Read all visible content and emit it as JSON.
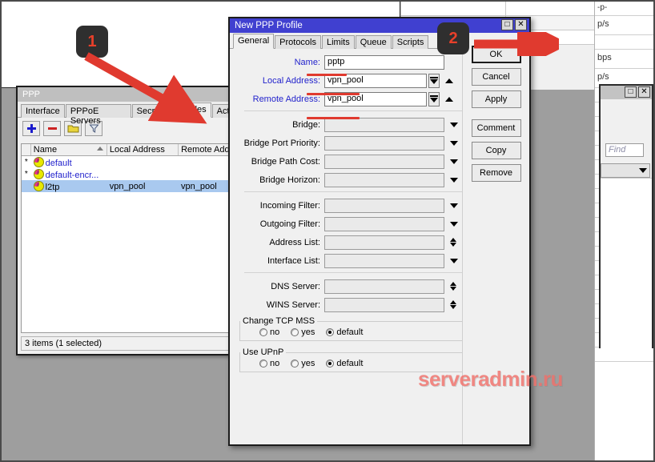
{
  "background": {
    "right_column_rows": [
      "-p-",
      "p/s",
      "",
      "bps",
      "p/s"
    ],
    "find_placeholder": "Find",
    "window_buttons": [
      "maximize-icon",
      "close-icon"
    ]
  },
  "ppp_window": {
    "title": "PPP",
    "tabs": [
      {
        "label": "Interface",
        "active": false
      },
      {
        "label": "PPPoE Servers",
        "active": false
      },
      {
        "label": "Secrets",
        "active": false
      },
      {
        "label": "Profiles",
        "active": true
      },
      {
        "label": "Acti",
        "active": false
      }
    ],
    "toolbar": [
      {
        "name": "add-button",
        "glyph": "+"
      },
      {
        "name": "remove-button",
        "glyph": "−"
      },
      {
        "name": "enable-button",
        "glyph": "folder"
      },
      {
        "name": "filter-button",
        "glyph": "funnel"
      }
    ],
    "columns": [
      "Name",
      "Local Address",
      "Remote Addre"
    ],
    "rows": [
      {
        "flag": "*",
        "name": "default",
        "local": "",
        "remote": "",
        "selected": false
      },
      {
        "flag": "*",
        "name": "default-encr...",
        "local": "",
        "remote": "",
        "selected": false
      },
      {
        "flag": "",
        "name": "l2tp",
        "local": "vpn_pool",
        "remote": "vpn_pool",
        "selected": true
      }
    ],
    "status": "3 items (1 selected)"
  },
  "dialog": {
    "title": "New PPP Profile",
    "window_buttons": [
      "maximize-icon",
      "close-icon"
    ],
    "tabs": [
      {
        "label": "General",
        "active": true
      },
      {
        "label": "Protocols",
        "active": false
      },
      {
        "label": "Limits",
        "active": false
      },
      {
        "label": "Queue",
        "active": false
      },
      {
        "label": "Scripts",
        "active": false
      }
    ],
    "fields": [
      {
        "label": "Name:",
        "value": "pptp",
        "highlight": true,
        "control": "text"
      },
      {
        "label": "Local Address:",
        "value": "vpn_pool",
        "highlight": true,
        "control": "combo-spin"
      },
      {
        "label": "Remote Address:",
        "value": "vpn_pool",
        "highlight": true,
        "control": "combo-spin"
      },
      {
        "label": "Bridge:",
        "value": "",
        "highlight": false,
        "control": "combo"
      },
      {
        "label": "Bridge Port Priority:",
        "value": "",
        "highlight": false,
        "control": "combo"
      },
      {
        "label": "Bridge Path Cost:",
        "value": "",
        "highlight": false,
        "control": "combo"
      },
      {
        "label": "Bridge Horizon:",
        "value": "",
        "highlight": false,
        "control": "combo"
      },
      {
        "label": "Incoming Filter:",
        "value": "",
        "highlight": false,
        "control": "combo"
      },
      {
        "label": "Outgoing Filter:",
        "value": "",
        "highlight": false,
        "control": "combo"
      },
      {
        "label": "Address List:",
        "value": "",
        "highlight": false,
        "control": "spin"
      },
      {
        "label": "Interface List:",
        "value": "",
        "highlight": false,
        "control": "combo"
      },
      {
        "label": "DNS Server:",
        "value": "",
        "highlight": false,
        "control": "spin"
      },
      {
        "label": "WINS Server:",
        "value": "",
        "highlight": false,
        "control": "spin"
      }
    ],
    "groups": [
      {
        "legend": "Change TCP MSS",
        "options": [
          {
            "label": "no",
            "selected": false
          },
          {
            "label": "yes",
            "selected": false
          },
          {
            "label": "default",
            "selected": true
          }
        ]
      },
      {
        "legend": "Use UPnP",
        "options": [
          {
            "label": "no",
            "selected": false
          },
          {
            "label": "yes",
            "selected": false
          },
          {
            "label": "default",
            "selected": true
          }
        ]
      }
    ],
    "buttons": [
      {
        "label": "OK",
        "primary": true
      },
      {
        "label": "Cancel",
        "primary": false
      },
      {
        "label": "Apply",
        "primary": false
      },
      {
        "label": "Comment",
        "primary": false
      },
      {
        "label": "Copy",
        "primary": false
      },
      {
        "label": "Remove",
        "primary": false
      }
    ]
  },
  "annotations": {
    "badge_one": "1",
    "badge_two": "2",
    "watermark": "serveradmin.ru",
    "accent_red": "#e03a2f",
    "title_blue": "#4040d0"
  }
}
